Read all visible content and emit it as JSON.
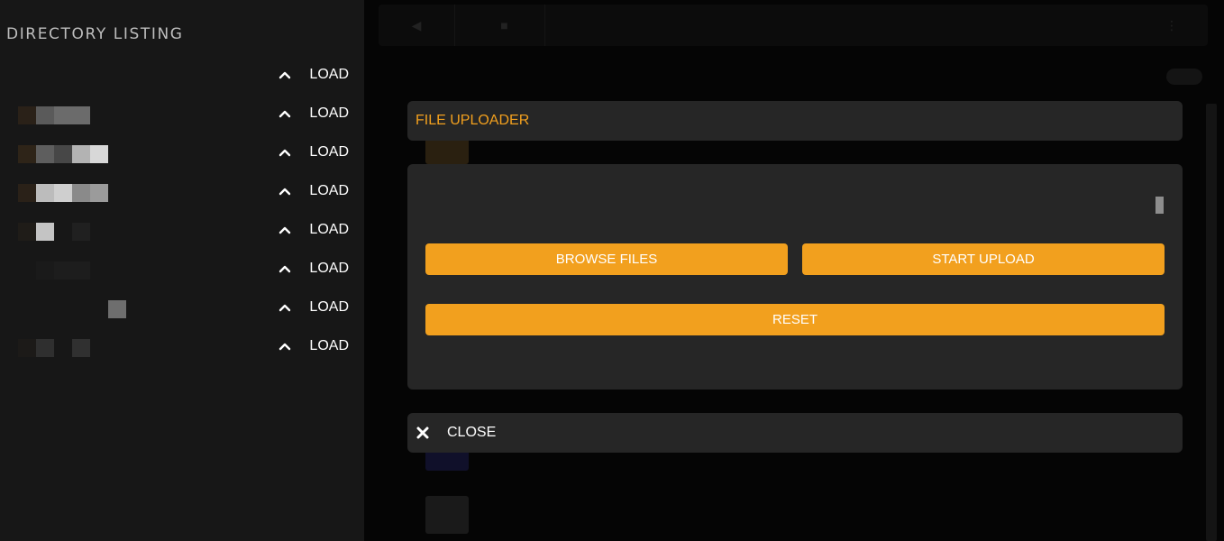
{
  "sidebar": {
    "title": "DIRECTORY LISTING",
    "load_label": "LOAD",
    "items": [
      {
        "label": "LOAD",
        "thumb": [
          "#171717",
          "#171717",
          "#171717",
          "#171717",
          "#171717",
          "#171717"
        ]
      },
      {
        "label": "LOAD",
        "thumb": [
          "#2a2118",
          "#5a5a5a",
          "#6b6b6b",
          "#6b6b6b",
          "#171717",
          "#171717"
        ]
      },
      {
        "label": "LOAD",
        "thumb": [
          "#2e2418",
          "#5e5e5e",
          "#474747",
          "#b3b3b3",
          "#d8d8d8",
          "#171717"
        ]
      },
      {
        "label": "LOAD",
        "thumb": [
          "#2a2118",
          "#bcbcbc",
          "#cfcfcf",
          "#8a8a8a",
          "#9b9b9b",
          "#171717"
        ]
      },
      {
        "label": "LOAD",
        "thumb": [
          "#1f1c18",
          "#c4c4c4",
          "#171717",
          "#202020",
          "#171717",
          "#171717"
        ]
      },
      {
        "label": "LOAD",
        "thumb": [
          "#171717",
          "#1a1a1a",
          "#1d1d1d",
          "#1d1d1d",
          "#171717",
          "#171717"
        ]
      },
      {
        "label": "LOAD",
        "thumb": [
          "#171717",
          "#171717",
          "#171717",
          "#171717",
          "#171717",
          "#6e6e6e"
        ]
      },
      {
        "label": "LOAD",
        "thumb": [
          "#1c1a18",
          "#2f2f2f",
          "#171717",
          "#303030",
          "#171717",
          "#171717"
        ]
      }
    ]
  },
  "uploader": {
    "title": "FILE UPLOADER",
    "browse_label": "BROWSE FILES",
    "start_label": "START UPLOAD",
    "reset_label": "RESET",
    "close_label": "CLOSE"
  },
  "colors": {
    "accent": "#f2a01e",
    "panel": "#262626",
    "sidebar": "#171717"
  },
  "icons": {
    "load": "chevron-up-icon",
    "close": "close-x-icon"
  }
}
